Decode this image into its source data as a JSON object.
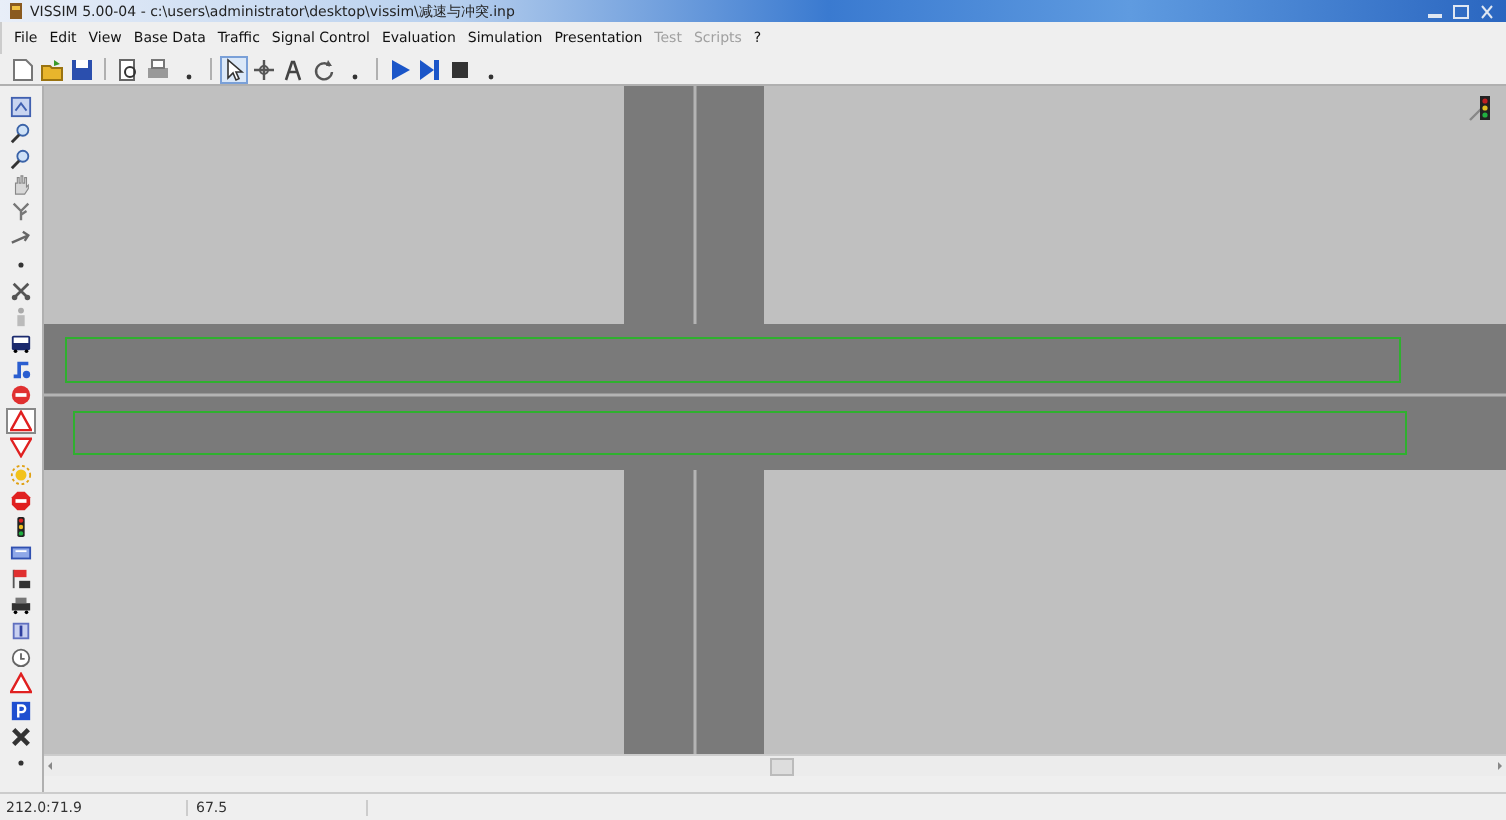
{
  "window": {
    "title": "VISSIM 5.00-04 - c:\\users\\administrator\\desktop\\vissim\\减速与冲突.inp"
  },
  "menu": [
    {
      "label": "File",
      "disabled": false
    },
    {
      "label": "Edit",
      "disabled": false
    },
    {
      "label": "View",
      "disabled": false
    },
    {
      "label": "Base Data",
      "disabled": false
    },
    {
      "label": "Traffic",
      "disabled": false
    },
    {
      "label": "Signal Control",
      "disabled": false
    },
    {
      "label": "Evaluation",
      "disabled": false
    },
    {
      "label": "Simulation",
      "disabled": false
    },
    {
      "label": "Presentation",
      "disabled": false
    },
    {
      "label": "Test",
      "disabled": true
    },
    {
      "label": "Scripts",
      "disabled": true
    },
    {
      "label": "?",
      "disabled": false
    }
  ],
  "toolbar": [
    {
      "kind": "new",
      "selected": false
    },
    {
      "kind": "open",
      "selected": false
    },
    {
      "kind": "save",
      "selected": false
    },
    {
      "kind": "sep"
    },
    {
      "kind": "preview",
      "selected": false
    },
    {
      "kind": "print",
      "selected": false
    },
    {
      "kind": "drop",
      "selected": false
    },
    {
      "kind": "sep"
    },
    {
      "kind": "pointer",
      "selected": true
    },
    {
      "kind": "move",
      "selected": false
    },
    {
      "kind": "text",
      "selected": false
    },
    {
      "kind": "rotate",
      "selected": false
    },
    {
      "kind": "drop",
      "selected": false
    },
    {
      "kind": "sep"
    },
    {
      "kind": "play",
      "selected": false
    },
    {
      "kind": "step",
      "selected": false
    },
    {
      "kind": "stop",
      "selected": false
    },
    {
      "kind": "drop",
      "selected": false
    }
  ],
  "left_toolbar": [
    {
      "kind": "window",
      "selected": false
    },
    {
      "kind": "magnifier",
      "selected": false
    },
    {
      "kind": "magnifier",
      "selected": false
    },
    {
      "kind": "hand",
      "selected": false
    },
    {
      "kind": "tree",
      "selected": false
    },
    {
      "kind": "arrow",
      "selected": false
    },
    {
      "kind": "dot",
      "selected": false
    },
    {
      "kind": "scissors",
      "selected": false
    },
    {
      "kind": "figure",
      "selected": false
    },
    {
      "kind": "bus",
      "selected": false
    },
    {
      "kind": "route",
      "selected": false
    },
    {
      "kind": "noentry",
      "selected": false
    },
    {
      "kind": "warning",
      "selected": true
    },
    {
      "kind": "yield",
      "selected": false
    },
    {
      "kind": "sun",
      "selected": false
    },
    {
      "kind": "stopsign",
      "selected": false
    },
    {
      "kind": "signal",
      "selected": false
    },
    {
      "kind": "detector",
      "selected": false
    },
    {
      "kind": "flag",
      "selected": false
    },
    {
      "kind": "car",
      "selected": false
    },
    {
      "kind": "bar",
      "selected": false
    },
    {
      "kind": "clock",
      "selected": false
    },
    {
      "kind": "warning",
      "selected": false
    },
    {
      "kind": "parking",
      "selected": false
    },
    {
      "kind": "cross",
      "selected": false
    },
    {
      "kind": "dot",
      "selected": false
    }
  ],
  "status_bar": {
    "coordinates": "212.0:71.9",
    "scale": "67.5"
  }
}
